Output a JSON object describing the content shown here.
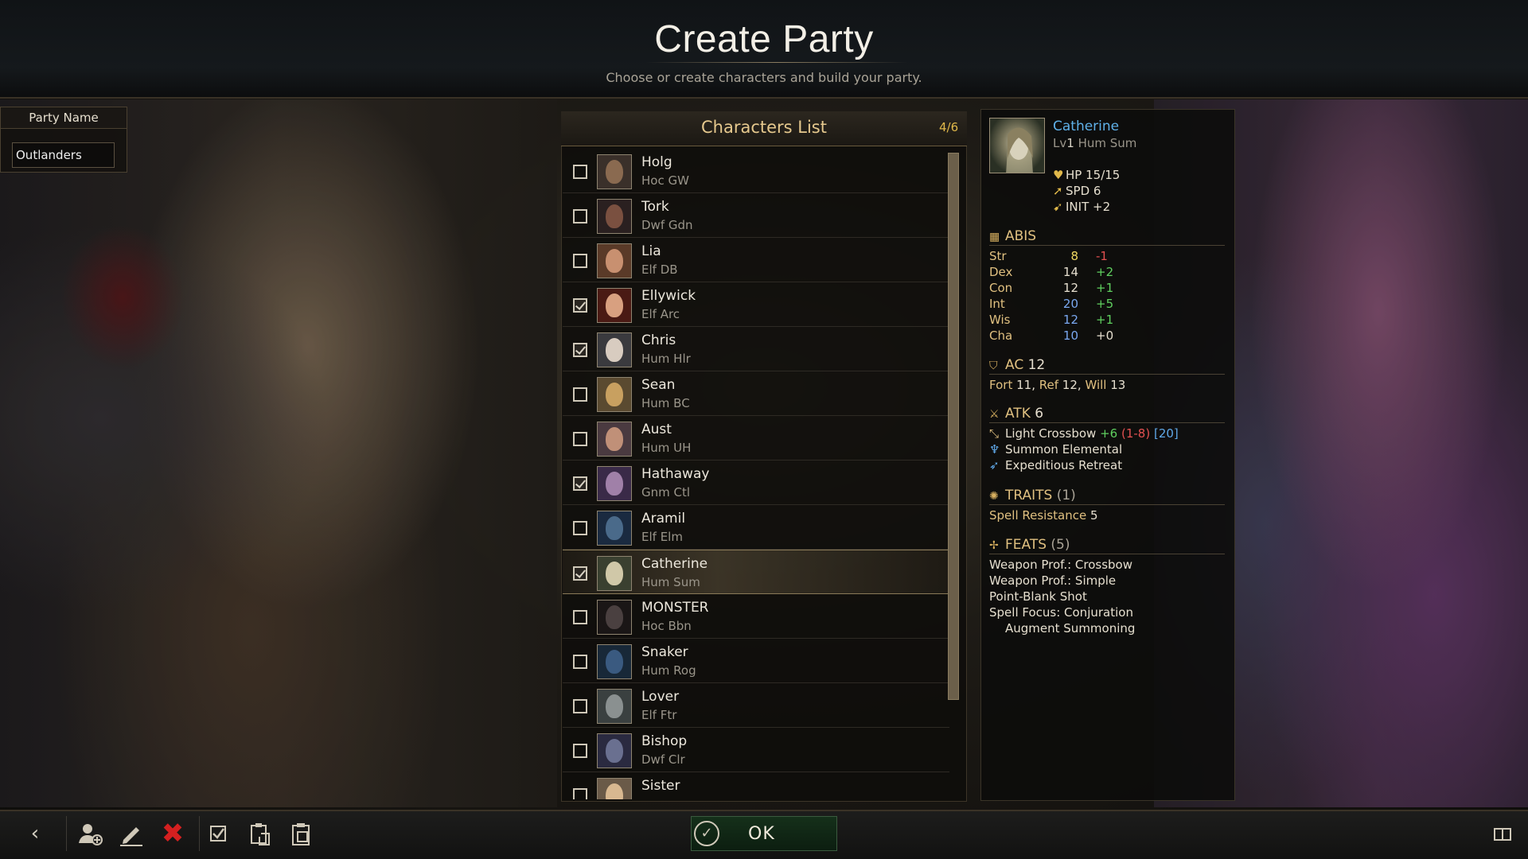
{
  "header": {
    "title": "Create Party",
    "subtitle": "Choose or create characters and build your party."
  },
  "party": {
    "label": "Party Name",
    "name": "Outlanders"
  },
  "characters_list": {
    "title": "Characters List",
    "count": "4/6",
    "items": [
      {
        "name": "Holg",
        "class": "Hoc GW",
        "checked": false,
        "face": "#8a6a50",
        "bg": "#3a302a"
      },
      {
        "name": "Tork",
        "class": "Dwf Gdn",
        "checked": false,
        "face": "#7a5040",
        "bg": "#2a2020"
      },
      {
        "name": "Lia",
        "class": "Elf DB",
        "checked": false,
        "face": "#c89070",
        "bg": "#5a3a28"
      },
      {
        "name": "Ellywick",
        "class": "Elf Arc",
        "checked": true,
        "face": "#d8a080",
        "bg": "#4a1a14"
      },
      {
        "name": "Chris",
        "class": "Hum Hlr",
        "checked": true,
        "face": "#d8ccc0",
        "bg": "#3a3a3e"
      },
      {
        "name": "Sean",
        "class": "Hum BC",
        "checked": false,
        "face": "#c8a060",
        "bg": "#5a4a30"
      },
      {
        "name": "Aust",
        "class": "Hum UH",
        "checked": false,
        "face": "#c09078",
        "bg": "#4a3a40"
      },
      {
        "name": "Hathaway",
        "class": "Gnm Ctl",
        "checked": true,
        "face": "#a080a8",
        "bg": "#3a2a48"
      },
      {
        "name": "Aramil",
        "class": "Elf Elm",
        "checked": false,
        "face": "#4a6a8a",
        "bg": "#1a2a40"
      },
      {
        "name": "Catherine",
        "class": "Hum Sum",
        "checked": true,
        "face": "#d0c8a8",
        "bg": "#3a4030",
        "selected": true
      },
      {
        "name": "MONSTER",
        "class": "Hoc Bbn",
        "checked": false,
        "face": "#4a4040",
        "bg": "#1a1616"
      },
      {
        "name": "Snaker",
        "class": "Hum Rog",
        "checked": false,
        "face": "#3a5a80",
        "bg": "#182838"
      },
      {
        "name": "Lover",
        "class": "Elf Ftr",
        "checked": false,
        "face": "#8a9090",
        "bg": "#3a4040"
      },
      {
        "name": "Bishop",
        "class": "Dwf Clr",
        "checked": false,
        "face": "#6a7090",
        "bg": "#2a2a40"
      },
      {
        "name": "Sister",
        "class": "",
        "checked": false,
        "face": "#d8b890",
        "bg": "#6a5a48"
      }
    ]
  },
  "detail": {
    "name": "Catherine",
    "level_prefix": "Lv",
    "level": "1",
    "class": "Hum Sum",
    "hp_label": "HP",
    "hp": "15/15",
    "spd_label": "SPD",
    "spd": "6",
    "init_label": "INIT",
    "init": "+2",
    "abis_title": "ABIS",
    "abilities": [
      {
        "name": "Str",
        "value": "8",
        "mod": "-1",
        "vcolor": "#f0d860",
        "mcolor": "#e25050"
      },
      {
        "name": "Dex",
        "value": "14",
        "mod": "+2",
        "vcolor": "#e6dfcf",
        "mcolor": "#5fcf5f"
      },
      {
        "name": "Con",
        "value": "12",
        "mod": "+1",
        "vcolor": "#e6dfcf",
        "mcolor": "#5fcf5f"
      },
      {
        "name": "Int",
        "value": "20",
        "mod": "+5",
        "vcolor": "#7aa8f0",
        "mcolor": "#5fcf5f"
      },
      {
        "name": "Wis",
        "value": "12",
        "mod": "+1",
        "vcolor": "#7aa8f0",
        "mcolor": "#5fcf5f"
      },
      {
        "name": "Cha",
        "value": "10",
        "mod": "+0",
        "vcolor": "#7aa8f0",
        "mcolor": "#e6dfcf"
      }
    ],
    "ac_label": "AC",
    "ac": "12",
    "fort_label": "Fort",
    "fort": "11,",
    "ref_label": "Ref",
    "ref": "12,",
    "will_label": "Will",
    "will": "13",
    "atk_label": "ATK",
    "atk": "6",
    "weapon": "Light Crossbow",
    "weapon_bonus": "+6",
    "weapon_damage": "(1-8)",
    "weapon_crit": "[20]",
    "spell1": "Summon Elemental",
    "spell2": "Expeditious Retreat",
    "traits_label": "TRAITS",
    "traits_count": "(1)",
    "trait1": "Spell Resistance",
    "trait1_val": "5",
    "feats_label": "FEATS",
    "feats_count": "(5)",
    "feats": [
      "Weapon Prof.: Crossbow",
      "Weapon Prof.: Simple",
      "Point-Blank Shot",
      "Spell Focus: Conjuration",
      "Augment Summoning"
    ]
  },
  "toolbar": {
    "ok_label": "OK"
  },
  "colors": {
    "accent_gold": "#e0c080",
    "link_blue": "#5fb0e8",
    "positive": "#5fcf5f",
    "negative": "#e25050"
  }
}
